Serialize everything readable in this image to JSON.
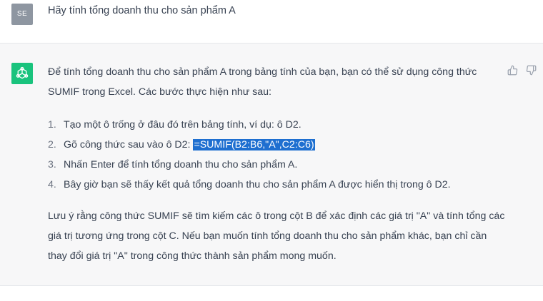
{
  "user_message": {
    "avatar_initials": "SE",
    "text": "Hãy tính tổng doanh thu cho sản phẩm A"
  },
  "assistant_message": {
    "intro": "Để tính tổng doanh thu cho sản phẩm A trong bảng tính của bạn, bạn có thể sử dụng công thức SUMIF trong Excel. Các bước thực hiện như sau:",
    "steps": [
      {
        "num": "1.",
        "text": "Tạo một ô trống ở đâu đó trên bảng tính, ví dụ: ô D2."
      },
      {
        "num": "2.",
        "text_before": "Gõ công thức sau vào ô D2: ",
        "formula": "=SUMIF(B2:B6,\"A\",C2:C6)"
      },
      {
        "num": "3.",
        "text": "Nhấn Enter để tính tổng doanh thu cho sản phẩm A."
      },
      {
        "num": "4.",
        "text": "Bây giờ bạn sẽ thấy kết quả tổng doanh thu cho sản phẩm A được hiển thị trong ô D2."
      }
    ],
    "note": "Lưu ý rằng công thức SUMIF sẽ tìm kiếm các ô trong cột B để xác định các giá trị \"A\" và tính tổng các giá trị tương ứng trong cột C. Nếu bạn muốn tính tổng doanh thu cho sản phẩm khác, bạn chỉ cần thay đổi giá trị \"A\" trong công thức thành sản phẩm mong muốn."
  },
  "colors": {
    "user_avatar_bg": "#8e96a1",
    "assistant_avatar_bg": "#19c37d",
    "assistant_row_bg": "#f7f7f8",
    "formula_highlight": "#1e6fd0"
  },
  "icons": {
    "assistant_avatar": "openai-logo-icon",
    "feedback_up": "thumbs-up-icon",
    "feedback_down": "thumbs-down-icon"
  }
}
